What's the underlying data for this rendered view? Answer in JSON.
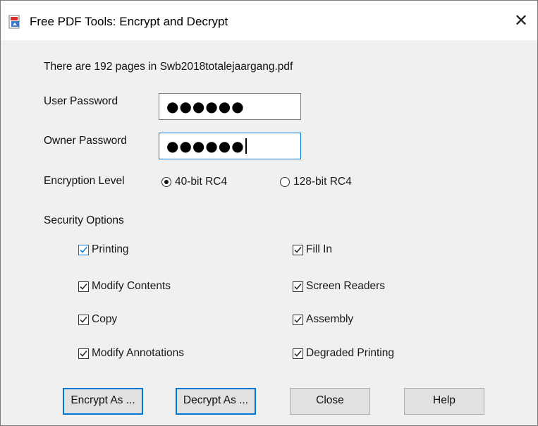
{
  "window": {
    "title": "Free PDF Tools:  Encrypt and Decrypt",
    "close_glyph": "✕"
  },
  "info_text": "There are 192 pages in Swb2018totalejaargang.pdf",
  "user_password": {
    "label": "User Password",
    "value": "●●●●●●"
  },
  "owner_password": {
    "label": "Owner Password",
    "value": "●●●●●●"
  },
  "encryption": {
    "label": "Encryption Level",
    "options": [
      {
        "label": "40-bit RC4",
        "selected": true
      },
      {
        "label": "128-bit RC4",
        "selected": false
      }
    ]
  },
  "security": {
    "label": "Security Options",
    "items": [
      {
        "label": "Printing",
        "checked": true
      },
      {
        "label": "Modify Contents",
        "checked": true
      },
      {
        "label": "Copy",
        "checked": true
      },
      {
        "label": "Modify Annotations",
        "checked": true
      },
      {
        "label": "Fill In",
        "checked": true
      },
      {
        "label": "Screen Readers",
        "checked": true
      },
      {
        "label": "Assembly",
        "checked": true
      },
      {
        "label": "Degraded Printing",
        "checked": true
      }
    ]
  },
  "buttons": {
    "encrypt": "Encrypt As ...",
    "decrypt": "Decrypt As ...",
    "close": "Close",
    "help": "Help"
  },
  "colors": {
    "accent": "#0078d7",
    "pdf_icon_red": "#d32f2f"
  }
}
